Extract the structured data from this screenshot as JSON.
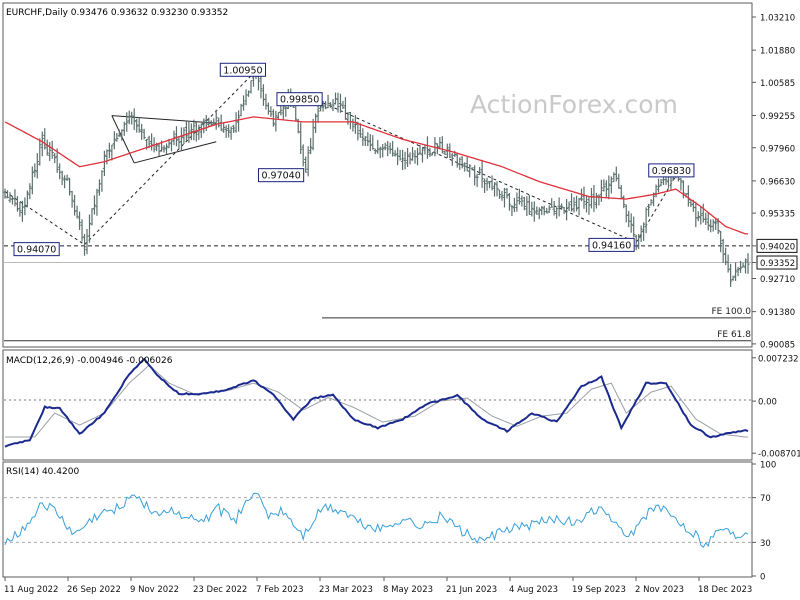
{
  "window": {
    "title": "EURCHF,Daily  0.93476 0.93632 0.93230 0.93352"
  },
  "watermark": "ActionForex.com",
  "colors": {
    "candles": "#5a6f6c",
    "ma": "#e0303a",
    "macd": "#1a2a8f",
    "signal": "#9aa0a6",
    "frame": "#5b5b5b",
    "label_border": "#1a237e",
    "grid_dash": "#333333"
  },
  "chart_data": [
    {
      "type": "candlestick",
      "title": "EURCHF,Daily  0.93476 0.93632 0.93230 0.93352",
      "ylim": [
        0.9,
        1.0321
      ],
      "y_ticks": [
        "1.03210",
        "1.01880",
        "1.00585",
        "0.99255",
        "0.97960",
        "0.96630",
        "0.95335",
        "0.94020",
        "0.93352",
        "0.92710",
        "0.91380",
        "0.90085"
      ],
      "x_ticks": [
        "11 Aug 2022",
        "26 Sep 2022",
        "9 Nov 2022",
        "23 Dec 2022",
        "7 Feb 2023",
        "23 Mar 2023",
        "8 May 2023",
        "21 Jun 2023",
        "4 Aug 2023",
        "19 Sep 2023",
        "2 Nov 2023",
        "18 Dec 2023"
      ],
      "price_path": [
        [
          0,
          0.962
        ],
        [
          7,
          0.954
        ],
        [
          15,
          0.983
        ],
        [
          25,
          0.965
        ],
        [
          32,
          0.941
        ],
        [
          40,
          0.975
        ],
        [
          50,
          0.993
        ],
        [
          62,
          0.978
        ],
        [
          72,
          0.985
        ],
        [
          85,
          0.99
        ],
        [
          92,
          0.986
        ],
        [
          100,
          1.0095
        ],
        [
          108,
          0.99
        ],
        [
          115,
          0.999
        ],
        [
          121,
          0.9705
        ],
        [
          126,
          0.996
        ],
        [
          133,
          0.998
        ],
        [
          145,
          0.982
        ],
        [
          160,
          0.976
        ],
        [
          175,
          0.98
        ],
        [
          190,
          0.969
        ],
        [
          205,
          0.957
        ],
        [
          220,
          0.954
        ],
        [
          238,
          0.959
        ],
        [
          245,
          0.9685
        ],
        [
          254,
          0.9416
        ],
        [
          262,
          0.965
        ],
        [
          270,
          0.9683
        ],
        [
          278,
          0.953
        ],
        [
          286,
          0.948
        ],
        [
          292,
          0.9263
        ],
        [
          298,
          0.9335
        ]
      ],
      "ma_path": [
        [
          0,
          0.99
        ],
        [
          15,
          0.982
        ],
        [
          30,
          0.972
        ],
        [
          40,
          0.974
        ],
        [
          55,
          0.979
        ],
        [
          70,
          0.984
        ],
        [
          85,
          0.989
        ],
        [
          100,
          0.992
        ],
        [
          120,
          0.99
        ],
        [
          140,
          0.99
        ],
        [
          160,
          0.983
        ],
        [
          180,
          0.978
        ],
        [
          200,
          0.972
        ],
        [
          215,
          0.966
        ],
        [
          235,
          0.96
        ],
        [
          250,
          0.959
        ],
        [
          262,
          0.961
        ],
        [
          270,
          0.963
        ],
        [
          280,
          0.956
        ],
        [
          290,
          0.948
        ],
        [
          298,
          0.945
        ]
      ],
      "annotations": [
        {
          "label": "1.00950",
          "level": 1.0095,
          "bar": 100
        },
        {
          "label": "0.99850",
          "level": 0.9985,
          "bar": 122
        },
        {
          "label": "0.97040",
          "level": 0.9704,
          "bar": 121
        },
        {
          "label": "0.94070",
          "level": 0.9407,
          "bar": 32
        },
        {
          "label": "0.94160",
          "level": 0.9416,
          "bar": 254
        },
        {
          "label": "0.96830",
          "level": 0.9683,
          "bar": 270
        }
      ],
      "levels": [
        {
          "value": 0.9402,
          "style": "dashed",
          "label": "0.94020"
        },
        {
          "value": 0.93352,
          "style": "solid",
          "label": "0.93352",
          "current": true
        },
        {
          "value": 0.9113,
          "style": "solid",
          "label": "FE 100.0"
        },
        {
          "value": 0.9021,
          "style": "solid",
          "label": "FE 61.8"
        }
      ]
    },
    {
      "type": "line",
      "title": "MACD(12,26,9) -0.004946 -0.006026",
      "ylim": [
        -0.0095,
        0.0082
      ],
      "y_ticks": [
        "0.007232",
        "0.00",
        "-0.008701"
      ],
      "series": [
        {
          "name": "MACD",
          "points": [
            [
              0,
              -0.0075
            ],
            [
              10,
              -0.0065
            ],
            [
              16,
              -0.001
            ],
            [
              22,
              -0.0012
            ],
            [
              30,
              -0.0055
            ],
            [
              40,
              -0.002
            ],
            [
              50,
              0.0045
            ],
            [
              56,
              0.007
            ],
            [
              62,
              0.004
            ],
            [
              70,
              0.0012
            ],
            [
              80,
              0.0012
            ],
            [
              90,
              0.002
            ],
            [
              100,
              0.0035
            ],
            [
              108,
              0.001
            ],
            [
              116,
              -0.003
            ],
            [
              124,
              0.0005
            ],
            [
              132,
              0.001
            ],
            [
              140,
              -0.003
            ],
            [
              150,
              -0.0045
            ],
            [
              160,
              -0.003
            ],
            [
              170,
              -0.0005
            ],
            [
              182,
              0.001
            ],
            [
              192,
              -0.003
            ],
            [
              202,
              -0.005
            ],
            [
              212,
              -0.002
            ],
            [
              222,
              -0.0035
            ],
            [
              232,
              0.0025
            ],
            [
              240,
              0.004
            ],
            [
              248,
              -0.0045
            ],
            [
              258,
              0.003
            ],
            [
              266,
              0.003
            ],
            [
              276,
              -0.004
            ],
            [
              284,
              -0.006
            ],
            [
              290,
              -0.0055
            ],
            [
              298,
              -0.0049
            ]
          ]
        },
        {
          "name": "Signal",
          "points": [
            [
              0,
              -0.006
            ],
            [
              12,
              -0.006
            ],
            [
              20,
              -0.002
            ],
            [
              30,
              -0.004
            ],
            [
              40,
              -0.002
            ],
            [
              50,
              0.003
            ],
            [
              58,
              0.006
            ],
            [
              66,
              0.003
            ],
            [
              76,
              0.0012
            ],
            [
              90,
              0.0018
            ],
            [
              100,
              0.003
            ],
            [
              110,
              0.0015
            ],
            [
              120,
              -0.0015
            ],
            [
              130,
              0.0006
            ],
            [
              140,
              -0.001
            ],
            [
              152,
              -0.0035
            ],
            [
              165,
              -0.0025
            ],
            [
              175,
              0
            ],
            [
              186,
              0.0005
            ],
            [
              196,
              -0.0025
            ],
            [
              206,
              -0.0042
            ],
            [
              216,
              -0.0025
            ],
            [
              226,
              -0.002
            ],
            [
              236,
              0.002
            ],
            [
              244,
              0.003
            ],
            [
              250,
              -0.002
            ],
            [
              260,
              0.0015
            ],
            [
              268,
              0.0025
            ],
            [
              278,
              -0.003
            ],
            [
              288,
              -0.0055
            ],
            [
              298,
              -0.006
            ]
          ]
        }
      ]
    },
    {
      "type": "line",
      "title": "RSI(14) 40.4200",
      "ylim": [
        0,
        100
      ],
      "y_ticks": [
        "100",
        "70",
        "30",
        "0"
      ],
      "levels": [
        70,
        30
      ],
      "series": [
        {
          "name": "RSI",
          "points": [
            [
              0,
              32
            ],
            [
              8,
              42
            ],
            [
              14,
              65
            ],
            [
              20,
              58
            ],
            [
              28,
              36
            ],
            [
              36,
              52
            ],
            [
              46,
              62
            ],
            [
              52,
              74
            ],
            [
              60,
              56
            ],
            [
              68,
              58
            ],
            [
              78,
              47
            ],
            [
              86,
              60
            ],
            [
              92,
              48
            ],
            [
              100,
              76
            ],
            [
              106,
              54
            ],
            [
              112,
              58
            ],
            [
              120,
              36
            ],
            [
              128,
              62
            ],
            [
              136,
              58
            ],
            [
              144,
              46
            ],
            [
              152,
              42
            ],
            [
              160,
              52
            ],
            [
              168,
              44
            ],
            [
              176,
              54
            ],
            [
              184,
              40
            ],
            [
              192,
              30
            ],
            [
              200,
              40
            ],
            [
              210,
              45
            ],
            [
              222,
              52
            ],
            [
              230,
              46
            ],
            [
              238,
              60
            ],
            [
              244,
              52
            ],
            [
              250,
              32
            ],
            [
              256,
              50
            ],
            [
              262,
              62
            ],
            [
              268,
              55
            ],
            [
              274,
              44
            ],
            [
              282,
              28
            ],
            [
              288,
              44
            ],
            [
              294,
              36
            ],
            [
              298,
              40
            ]
          ]
        }
      ]
    }
  ]
}
